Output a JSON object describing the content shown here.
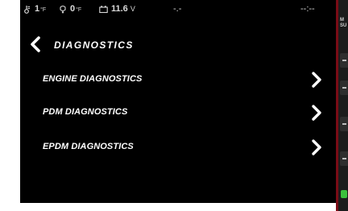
{
  "status": {
    "temp1_value": "1",
    "temp1_unit": "°F",
    "temp2_value": "0",
    "temp2_unit": "°F",
    "battery_value": "11.6",
    "battery_unit": "V",
    "field1": "-.-",
    "clock": "--:--"
  },
  "header": {
    "title": "DIAGNOSTICS"
  },
  "menu": {
    "items": [
      {
        "label": "ENGINE DIAGNOSTICS"
      },
      {
        "label": "PDM DIAGNOSTICS"
      },
      {
        "label": "EPDM DIAGNOSTICS"
      }
    ]
  },
  "rail": {
    "line1": "M",
    "line2": "SU"
  },
  "colors": {
    "background": "#000000",
    "text": "#ffffff",
    "status_text": "#d9d9d9",
    "rail_accent": "#7a0c16",
    "rail_indicator": "#3cc03c"
  }
}
